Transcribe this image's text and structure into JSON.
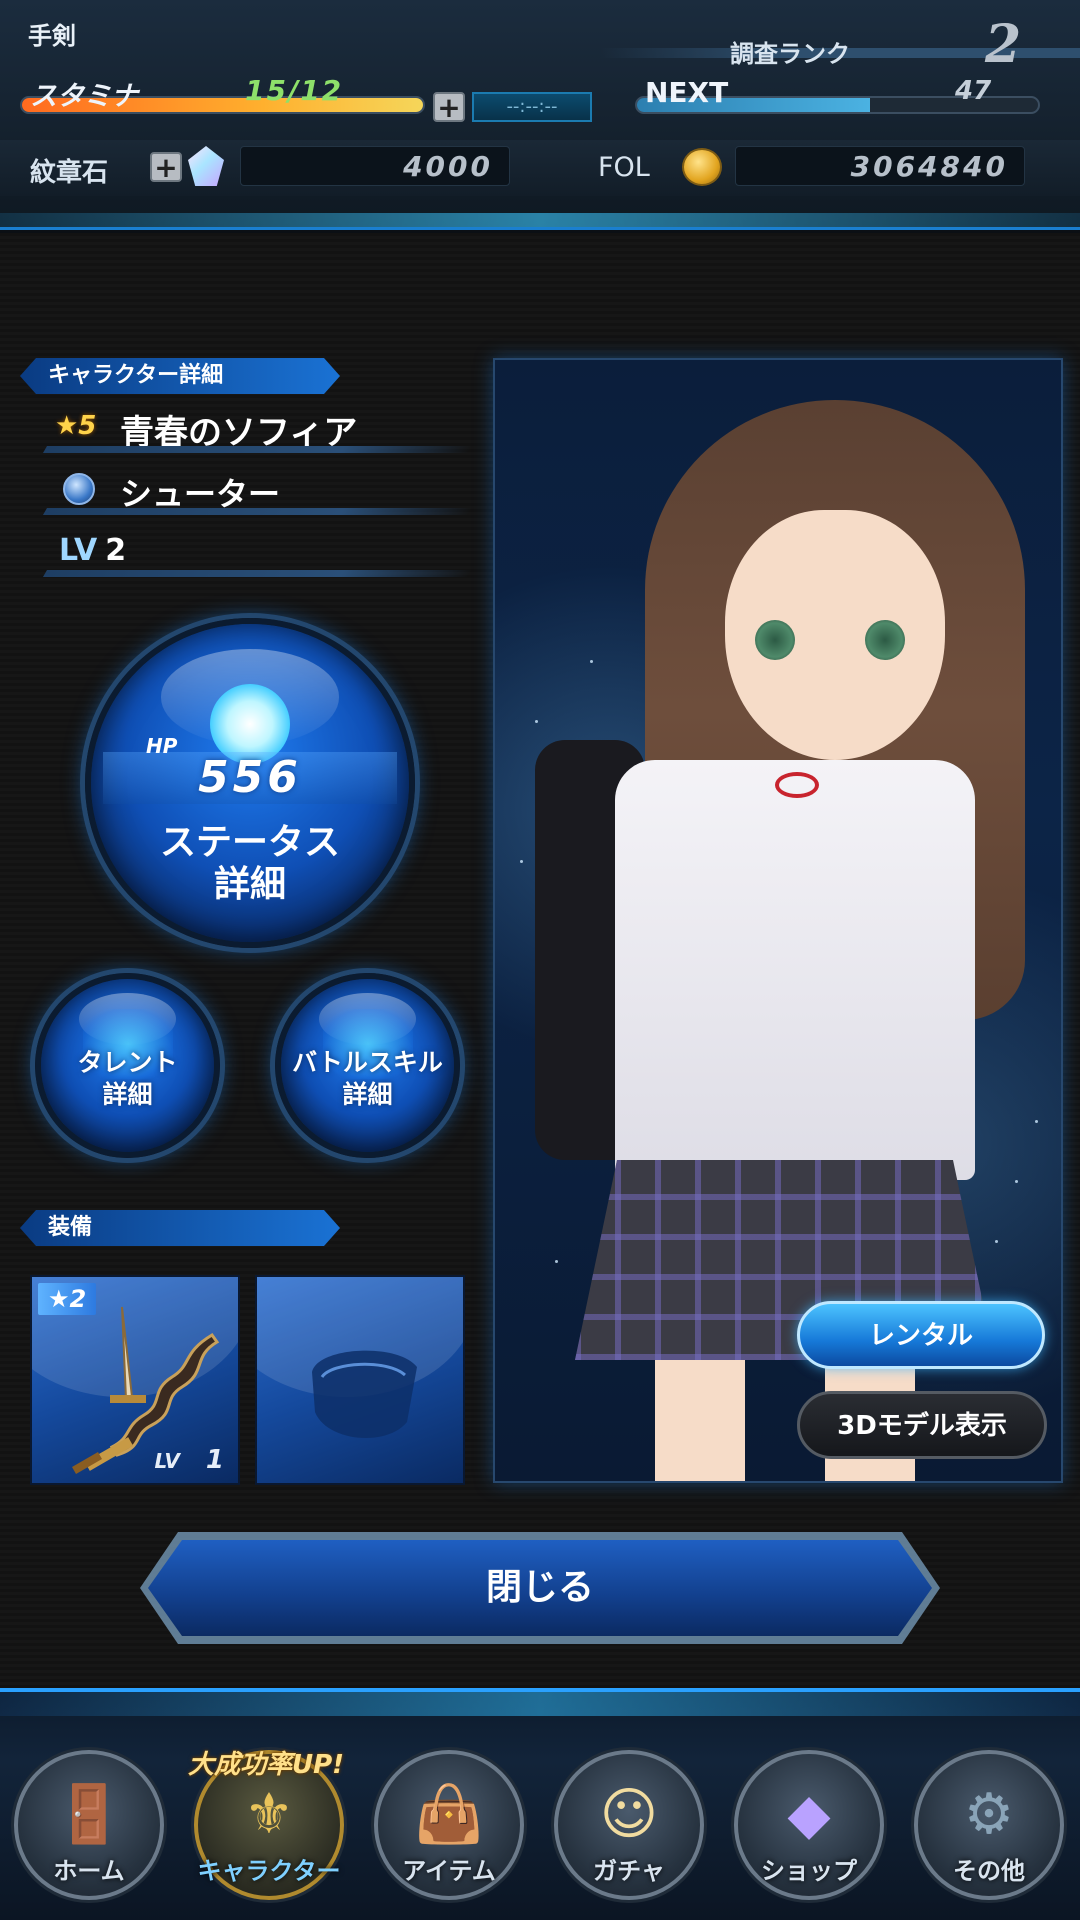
{
  "header": {
    "player_name": "手剣",
    "rank_label": "調査ランク",
    "rank_value": "2",
    "stamina_label": "スタミナ",
    "stamina_value": "15/12",
    "stamina_fill": 1.0,
    "plus_symbol": "+",
    "stamina_timer": "--:--:--",
    "next_label": "NEXT",
    "next_value": "47",
    "next_fill": 0.58,
    "stone_label": "紋章石",
    "stone_icon": "crest-stone-icon",
    "stone_value": "4000",
    "fol_label": "FOL",
    "fol_icon": "gold-coin-icon",
    "fol_value": "3064840"
  },
  "detail": {
    "section_title": "キャラクター詳細",
    "rarity": "★5",
    "character_name": "青春のソフィア",
    "class_icon": "shooter-class-icon",
    "class_name": "シューター",
    "lv_label": "LV",
    "lv_value": "2"
  },
  "status_orb": {
    "hp_label": "HP",
    "hp_value": "556",
    "label_line1": "ステータス",
    "label_line2": "詳細"
  },
  "talent_orb": {
    "line1": "タレント",
    "line2": "詳細"
  },
  "skill_orb": {
    "line1": "バトルスキル",
    "line2": "詳細"
  },
  "equipment": {
    "section_title": "装備",
    "weapon": {
      "stars": "★2",
      "lv_label": "LV",
      "lv_value": "1",
      "icon": "sword-icon"
    },
    "accessory": {
      "icon": "bracelet-icon"
    }
  },
  "art_panel": {
    "rental_label": "レンタル",
    "model_label": "3Dモデル表示"
  },
  "close_label": "閉じる",
  "footer": {
    "promo": "大成功率UP!",
    "items": [
      {
        "label": "ホーム",
        "icon": "door-icon"
      },
      {
        "label": "キャラクター",
        "icon": "character-icon"
      },
      {
        "label": "アイテム",
        "icon": "bag-icon"
      },
      {
        "label": "ガチャ",
        "icon": "gacha-icon"
      },
      {
        "label": "ショップ",
        "icon": "crystal-icon"
      },
      {
        "label": "その他",
        "icon": "gear-icon"
      }
    ]
  },
  "colors": {
    "accent": "#1a72d4",
    "stamina_bar": "#ffb02e",
    "stamina_text": "#8ee06a"
  }
}
